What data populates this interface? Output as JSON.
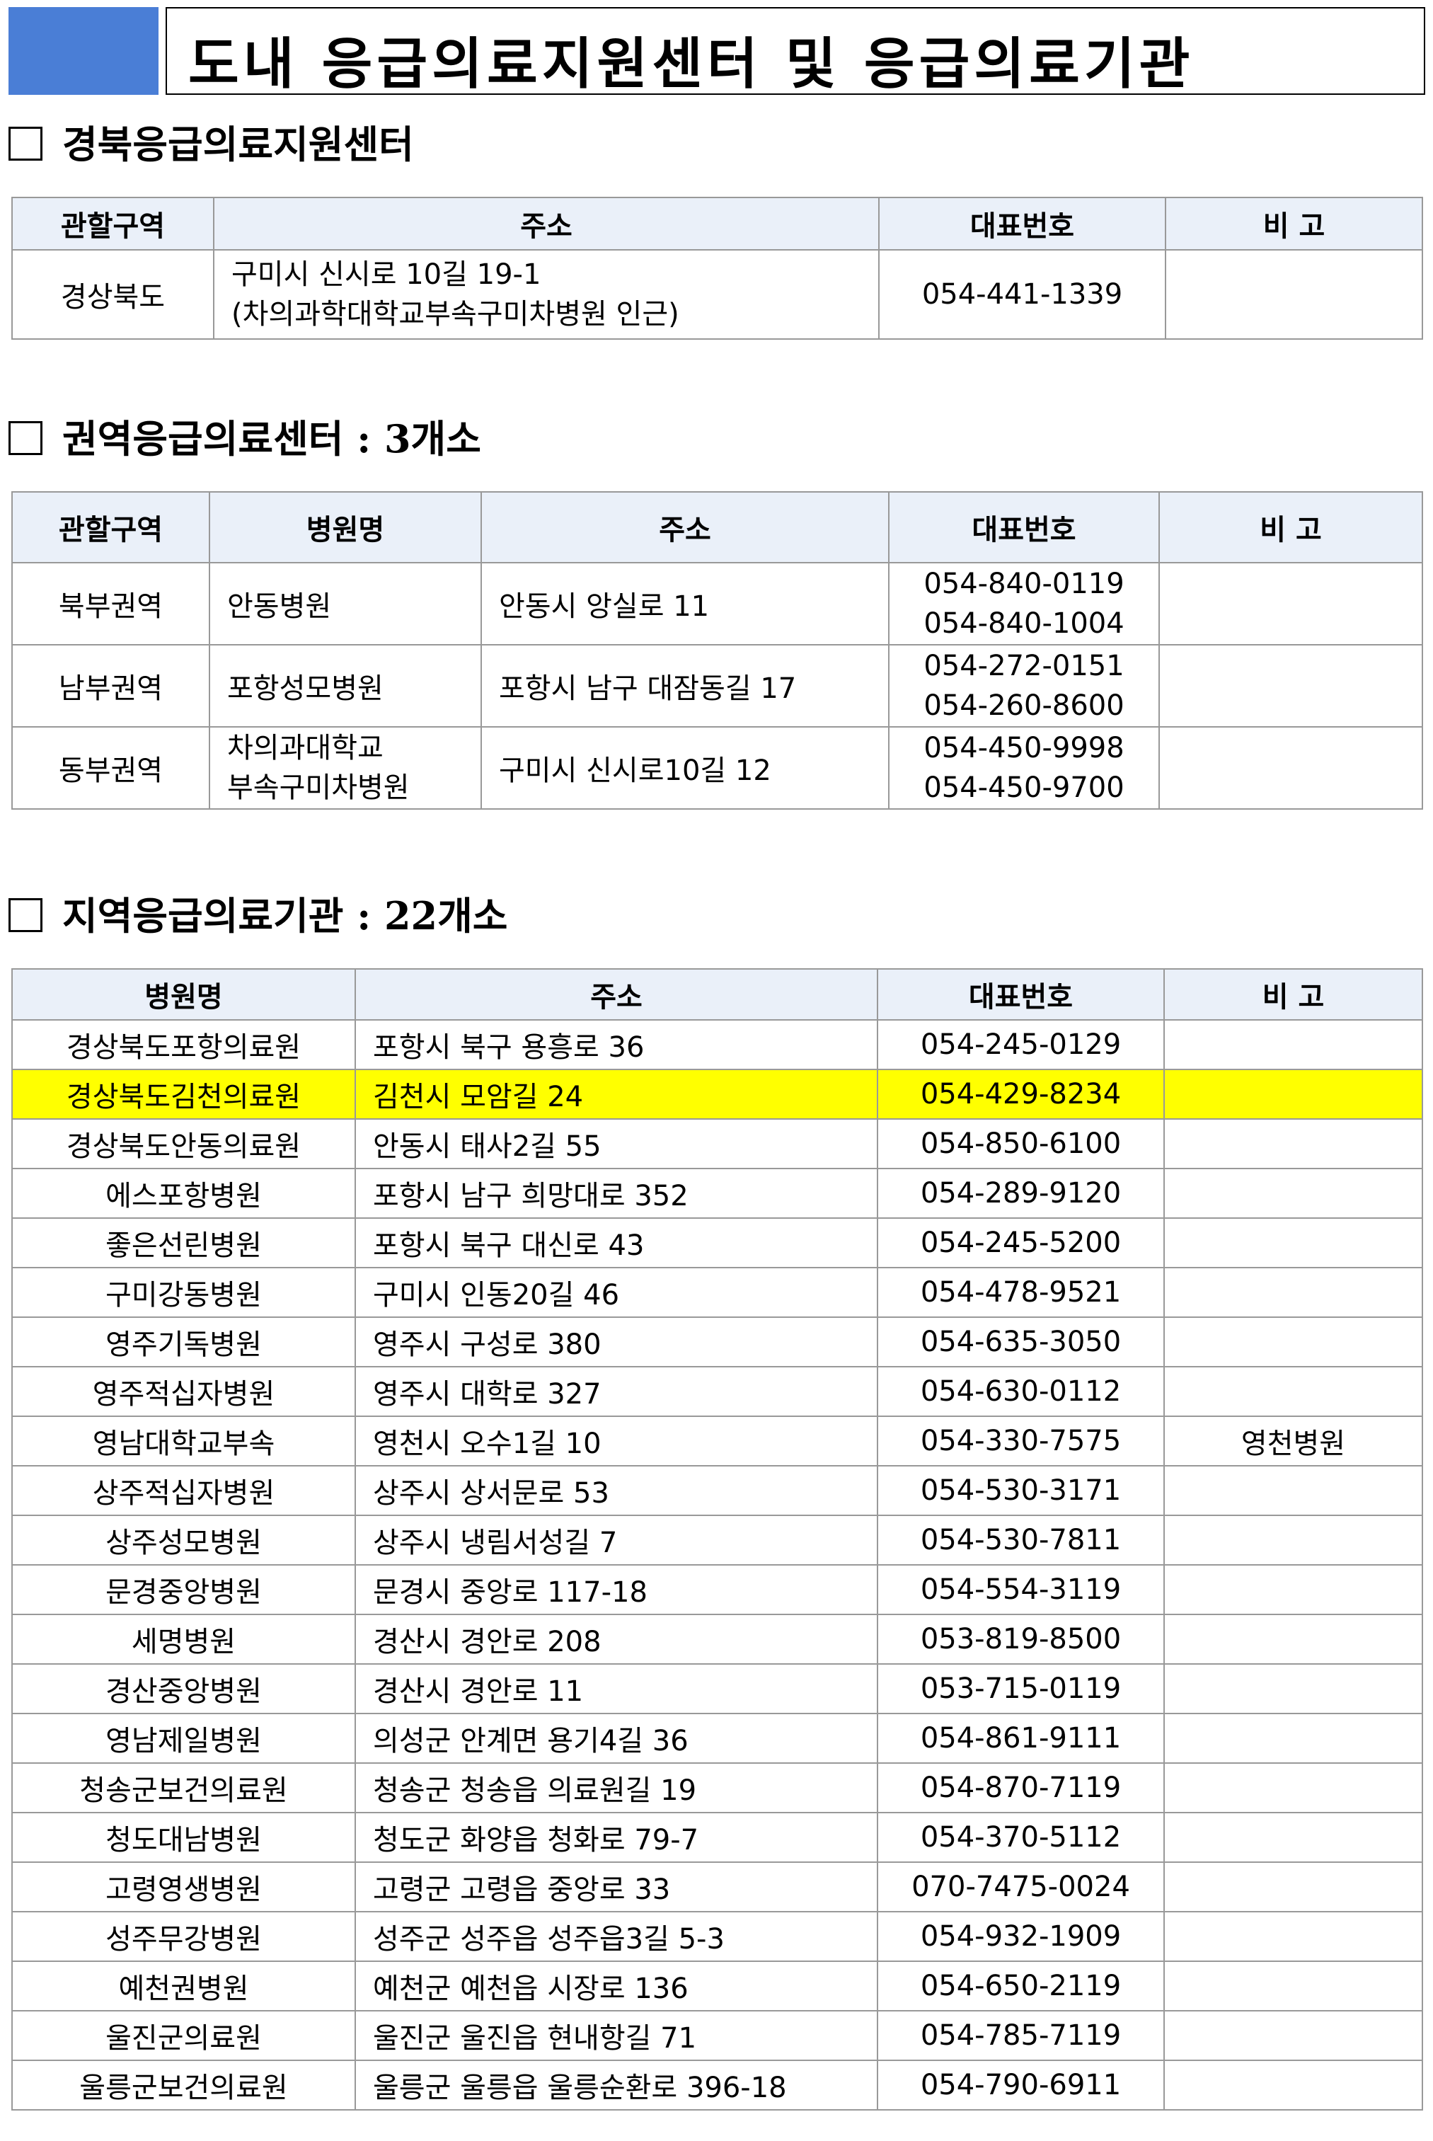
{
  "title": "도내 응급의료지원센터 및 응급의료기관",
  "section1": {
    "heading": "경북응급의료지원센터",
    "headers": [
      "관할구역",
      "주소",
      "대표번호",
      "비  고"
    ],
    "row": {
      "region": "경상북도",
      "address_line1": "구미시 신시로 10길 19-1",
      "address_line2": "(차의과학대학교부속구미차병원 인근)",
      "phone": "054-441-1339",
      "note": ""
    }
  },
  "section2": {
    "heading": "권역응급의료센터 : 3개소",
    "headers": [
      "관할구역",
      "병원명",
      "주소",
      "대표번호",
      "비  고"
    ],
    "rows": [
      {
        "region": "북부권역",
        "name_line1": "안동병원",
        "name_line2": "",
        "address": "안동시 앙실로 11",
        "phone1": "054-840-0119",
        "phone2": "054-840-1004",
        "note": ""
      },
      {
        "region": "남부권역",
        "name_line1": "포항성모병원",
        "name_line2": "",
        "address": "포항시 남구 대잠동길 17",
        "phone1": "054-272-0151",
        "phone2": "054-260-8600",
        "note": ""
      },
      {
        "region": "동부권역",
        "name_line1": "차의과대학교",
        "name_line2": "부속구미차병원",
        "address": "구미시 신시로10길 12",
        "phone1": "054-450-9998",
        "phone2": "054-450-9700",
        "note": ""
      }
    ]
  },
  "section3": {
    "heading": "지역응급의료기관 : 22개소",
    "headers": [
      "병원명",
      "주소",
      "대표번호",
      "비  고"
    ],
    "rows": [
      {
        "name": "경상북도포항의료원",
        "address": "포항시 북구 용흥로 36",
        "phone": "054-245-0129",
        "note": ""
      },
      {
        "name": "경상북도김천의료원",
        "address": "김천시 모암길 24",
        "phone": "054-429-8234",
        "note": ""
      },
      {
        "name": "경상북도안동의료원",
        "address": "안동시 태사2길 55",
        "phone": "054-850-6100",
        "note": ""
      },
      {
        "name": "에스포항병원",
        "address": "포항시 남구 희망대로 352",
        "phone": "054-289-9120",
        "note": ""
      },
      {
        "name": "좋은선린병원",
        "address": "포항시 북구 대신로 43",
        "phone": "054-245-5200",
        "note": ""
      },
      {
        "name": "구미강동병원",
        "address": "구미시 인동20길 46",
        "phone": "054-478-9521",
        "note": ""
      },
      {
        "name": "영주기독병원",
        "address": "영주시 구성로 380",
        "phone": "054-635-3050",
        "note": ""
      },
      {
        "name": "영주적십자병원",
        "address": "영주시 대학로 327",
        "phone": "054-630-0112",
        "note": ""
      },
      {
        "name": "영남대학교부속",
        "address": "영천시 오수1길 10",
        "phone": "054-330-7575",
        "note": "영천병원"
      },
      {
        "name": "상주적십자병원",
        "address": "상주시 상서문로 53",
        "phone": "054-530-3171",
        "note": ""
      },
      {
        "name": "상주성모병원",
        "address": "상주시 냉림서성길 7",
        "phone": "054-530-7811",
        "note": ""
      },
      {
        "name": "문경중앙병원",
        "address": "문경시 중앙로 117-18",
        "phone": "054-554-3119",
        "note": ""
      },
      {
        "name": "세명병원",
        "address": "경산시 경안로 208",
        "phone": "053-819-8500",
        "note": ""
      },
      {
        "name": "경산중앙병원",
        "address": "경산시 경안로 11",
        "phone": "053-715-0119",
        "note": ""
      },
      {
        "name": "영남제일병원",
        "address": "의성군 안계면 용기4길 36",
        "phone": "054-861-9111",
        "note": ""
      },
      {
        "name": "청송군보건의료원",
        "address": "청송군 청송읍 의료원길 19",
        "phone": "054-870-7119",
        "note": ""
      },
      {
        "name": "청도대남병원",
        "address": "청도군 화양읍 청화로 79-7",
        "phone": "054-370-5112",
        "note": ""
      },
      {
        "name": "고령영생병원",
        "address": "고령군 고령읍 중앙로 33",
        "phone": "070-7475-0024",
        "note": ""
      },
      {
        "name": "성주무강병원",
        "address": "성주군 성주읍 성주읍3길 5-3",
        "phone": "054-932-1909",
        "note": ""
      },
      {
        "name": "예천권병원",
        "address": "예천군 예천읍 시장로 136",
        "phone": "054-650-2119",
        "note": ""
      },
      {
        "name": "울진군의료원",
        "address": "울진군 울진읍 현내항길 71",
        "phone": "054-785-7119",
        "note": ""
      },
      {
        "name": "울릉군보건의료원",
        "address": "울릉군 울릉읍 울릉순환로 396-18",
        "phone": "054-790-6911",
        "note": ""
      }
    ],
    "highlight_color": "#ffff00"
  },
  "colors": {
    "header_block": "#4a7ed6",
    "table_header_bg": "#eaf0f9",
    "highlight": "#ffff00"
  }
}
